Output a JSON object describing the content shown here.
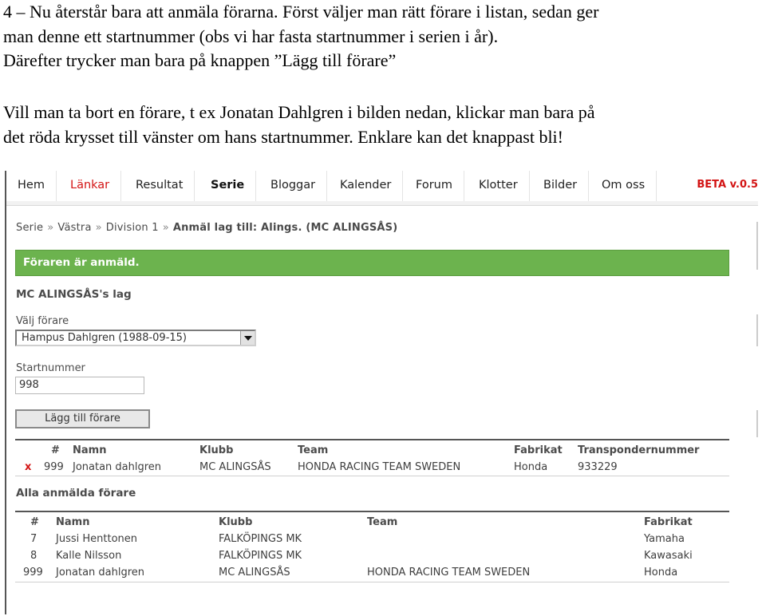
{
  "doc": {
    "para1": [
      "4 – Nu återstår bara att anmäla förarna. Först väljer man rätt förare i listan, sedan ger",
      "man denne ett startnummer (obs vi har fasta startnummer i serien i år).",
      "Därefter trycker man bara på knappen ”Lägg till förare”"
    ],
    "para2": [
      "Vill man ta bort en förare, t ex Jonatan Dahlgren i bilden nedan, klickar man bara på",
      "det röda krysset till vänster om hans startnummer. Enklare kan det knappast bli!"
    ]
  },
  "nav": {
    "items": [
      "Hem",
      "Länkar",
      "Resultat",
      "Serie",
      "Bloggar",
      "Kalender",
      "Forum",
      "Klotter",
      "Bilder",
      "Om oss"
    ],
    "active": "Serie",
    "beta": "BETA v.0.5"
  },
  "breadcrumb": {
    "items": [
      "Serie",
      "Västra",
      "Division 1"
    ],
    "current": "Anmäl lag till: Alings. (MC ALINGSÅS)",
    "separator": "»"
  },
  "notice": {
    "text": "Föraren är anmäld.",
    "color": "#6cb34e"
  },
  "form": {
    "team_heading": "MC ALINGSÅS's lag",
    "driver_label": "Välj förare",
    "driver_selected": "Hampus Dahlgren (1988-09-15)",
    "start_label": "Startnummer",
    "start_value": "998",
    "submit_label": "Lägg till förare"
  },
  "team_table": {
    "headers": [
      "#",
      "Namn",
      "Klubb",
      "Team",
      "Fabrikat",
      "Transpondernummer"
    ],
    "rows": [
      {
        "delete": "x",
        "nr": "999",
        "name": "Jonatan dahlgren",
        "club": "MC ALINGSÅS",
        "team": "HONDA RACING TEAM SWEDEN",
        "make": "Honda",
        "transponder": "933229"
      }
    ]
  },
  "all_drivers": {
    "heading": "Alla anmälda förare",
    "headers": [
      "#",
      "Namn",
      "Klubb",
      "Team",
      "Fabrikat"
    ],
    "rows": [
      {
        "nr": "7",
        "name": "Jussi Henttonen",
        "club": "FALKÖPINGS MK",
        "team": "",
        "make": "Yamaha"
      },
      {
        "nr": "8",
        "name": "Kalle Nilsson",
        "club": "FALKÖPINGS MK",
        "team": "",
        "make": "Kawasaki"
      },
      {
        "nr": "999",
        "name": "Jonatan dahlgren",
        "club": "MC ALINGSÅS",
        "team": "HONDA RACING TEAM SWEDEN",
        "make": "Honda"
      }
    ]
  },
  "colors": {
    "accent_red": "#d31414",
    "success_green": "#6cb34e"
  }
}
